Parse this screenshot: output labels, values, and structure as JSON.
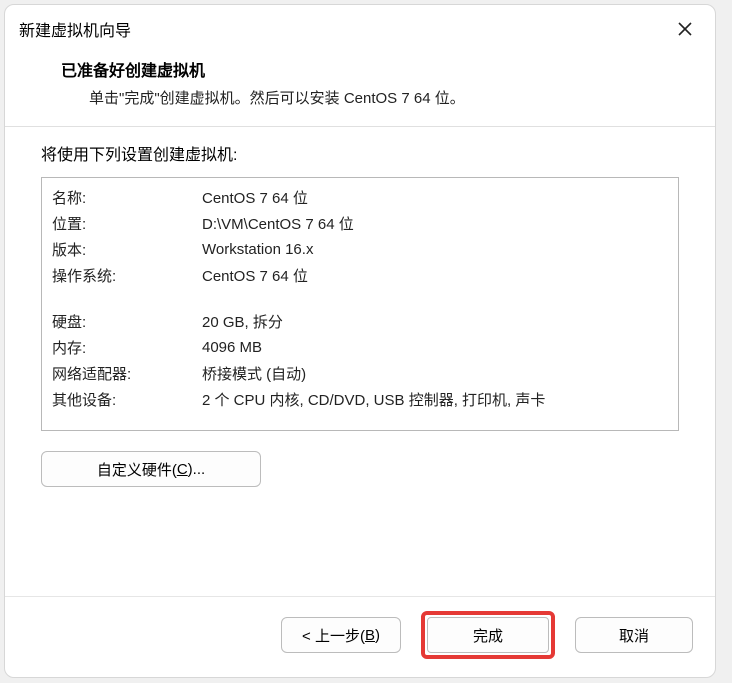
{
  "window": {
    "title": "新建虚拟机向导"
  },
  "header": {
    "heading": "已准备好创建虚拟机",
    "subtitle": "单击\"完成\"创建虚拟机。然后可以安装 CentOS 7 64 位。"
  },
  "body": {
    "intro": "将使用下列设置创建虚拟机:",
    "rows": [
      {
        "key": "名称:",
        "val": "CentOS 7 64 位"
      },
      {
        "key": "位置:",
        "val": "D:\\VM\\CentOS 7 64 位"
      },
      {
        "key": "版本:",
        "val": "Workstation 16.x"
      },
      {
        "key": "操作系统:",
        "val": "CentOS 7 64 位"
      }
    ],
    "rows2": [
      {
        "key": "硬盘:",
        "val": "20 GB, 拆分"
      },
      {
        "key": "内存:",
        "val": "4096 MB"
      },
      {
        "key": "网络适配器:",
        "val": "桥接模式 (自动)"
      },
      {
        "key": "其他设备:",
        "val": "2 个 CPU 内核, CD/DVD, USB 控制器, 打印机, 声卡"
      }
    ],
    "customize_pre": "自定义硬件(",
    "customize_u": "C",
    "customize_post": ")..."
  },
  "footer": {
    "back_pre": "< 上一步(",
    "back_u": "B",
    "back_post": ")",
    "finish": "完成",
    "cancel": "取消"
  }
}
